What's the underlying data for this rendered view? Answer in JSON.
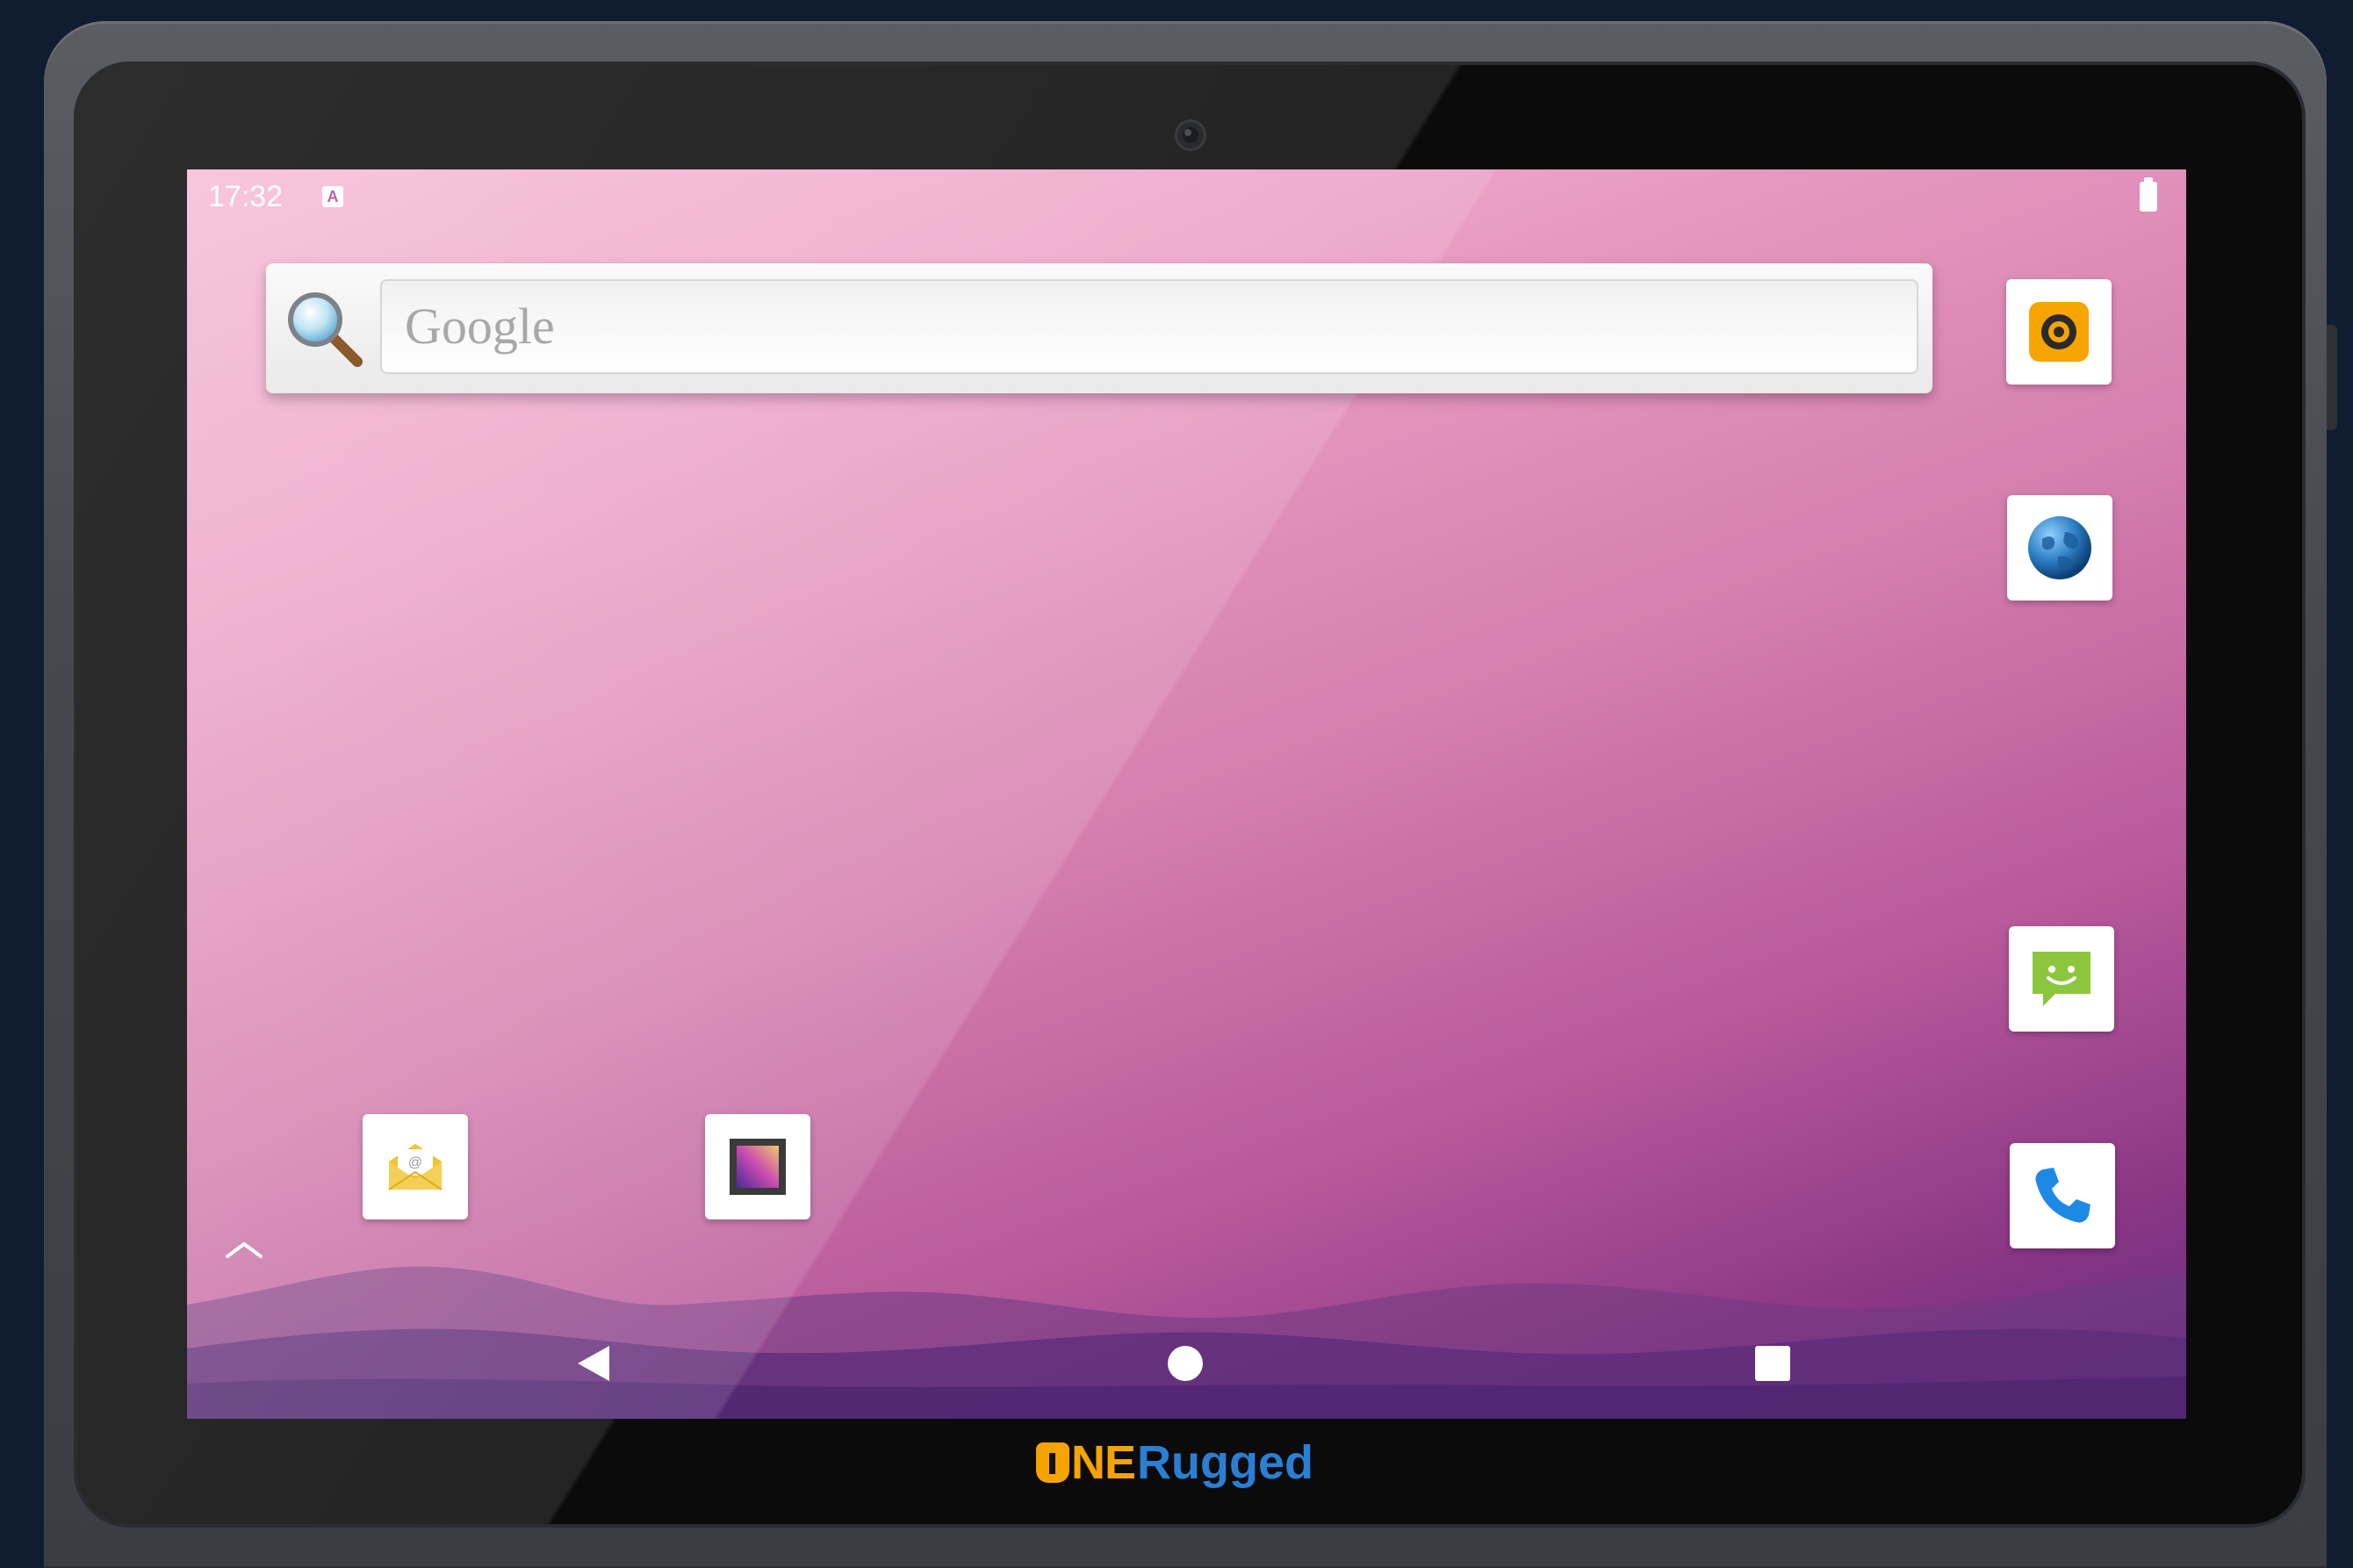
{
  "status_bar": {
    "time": "17:32",
    "notification_icon_letter": "A",
    "battery_icon": "battery-icon"
  },
  "search_widget": {
    "search_icon": "magnifier-icon",
    "placeholder": "Google"
  },
  "apps": [
    {
      "name": "Camera",
      "icon": "camera-shutter-icon",
      "accent": "#f7a400"
    },
    {
      "name": "Browser",
      "icon": "globe-icon",
      "accent": "#2a7bbf"
    },
    {
      "name": "Messaging",
      "icon": "smiley-chat-icon",
      "accent": "#8cc63f"
    },
    {
      "name": "Phone",
      "icon": "phone-icon",
      "accent": "#1e88e5"
    },
    {
      "name": "Email",
      "icon": "envelope-icon",
      "accent": "#f2c233"
    },
    {
      "name": "Gallery",
      "icon": "picture-icon",
      "accent": "#6a3fb5"
    }
  ],
  "app_drawer_icon": "chevron-up-icon",
  "nav_bar": {
    "back": "back-triangle-icon",
    "home": "home-circle-icon",
    "recents": "recents-square-icon"
  },
  "device_brand": {
    "prefix": "NE",
    "suffix": "Rugged",
    "colors": {
      "prefix": "#f5a300",
      "suffix": "#2a7fd4"
    }
  },
  "colors": {
    "wallpaper_top": "#f7b6d2",
    "wallpaper_bottom": "#5d2a7a",
    "device_body": "#45484d"
  }
}
